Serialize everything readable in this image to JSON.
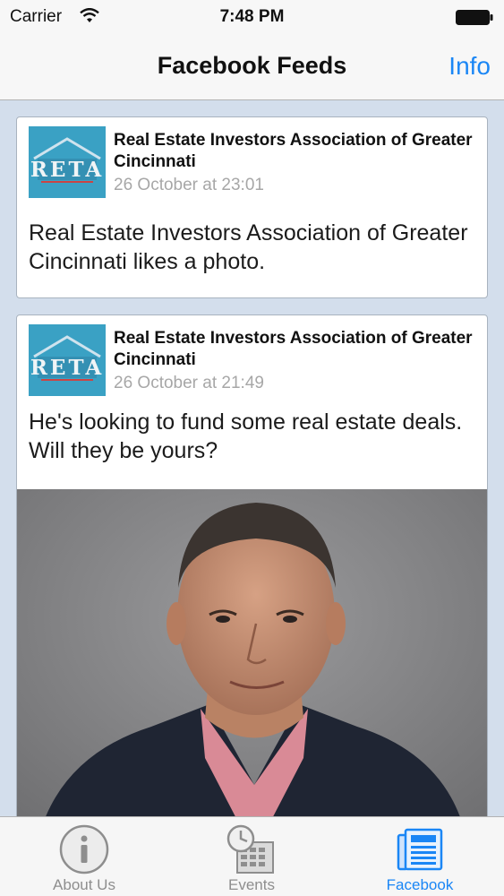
{
  "status_bar": {
    "carrier": "Carrier",
    "time": "7:48 PM"
  },
  "nav": {
    "title": "Facebook Feeds",
    "info_label": "Info"
  },
  "posts": [
    {
      "author": "Real Estate Investors Association of Greater Cincinnati",
      "timestamp": "26 October at 23:01",
      "message": "Real Estate Investors Association of Greater Cincinnati likes a photo."
    },
    {
      "author": "Real Estate Investors Association of Greater Cincinnati",
      "timestamp": "26 October at 21:49",
      "message": "He's looking to fund some real estate deals. Will they be yours?"
    }
  ],
  "logo_text": "RETA",
  "tabs": [
    {
      "label": "About Us",
      "icon": "info-circle-icon",
      "active": false
    },
    {
      "label": "Events",
      "icon": "calendar-clock-icon",
      "active": false
    },
    {
      "label": "Facebook",
      "icon": "newspaper-icon",
      "active": true
    }
  ],
  "colors": {
    "accent": "#1a86f5",
    "background": "#d3deec",
    "timestamp": "#a7a7a7",
    "logo_bg": "#3aa1c4"
  }
}
